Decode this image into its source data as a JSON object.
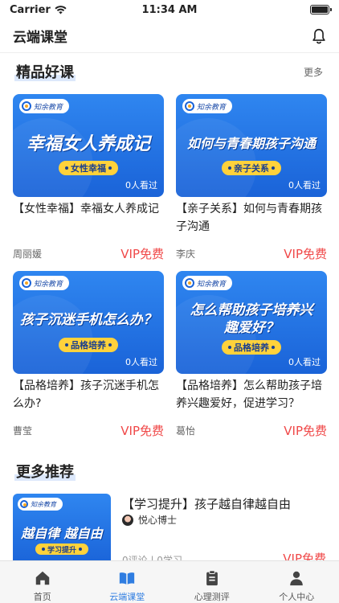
{
  "status": {
    "carrier": "Carrier",
    "time": "11:34 AM"
  },
  "header": {
    "title": "云端课堂"
  },
  "featured": {
    "title": "精品好课",
    "more": "更多",
    "courses": [
      {
        "thumb_title": "幸福女人养成记",
        "tag": "女性幸福",
        "views": "0人看过",
        "title": "【女性幸福】幸福女人养成记",
        "author": "周丽媛",
        "price": "VIP免费"
      },
      {
        "thumb_title": "如何与青春期孩子沟通",
        "tag": "亲子关系",
        "views": "0人看过",
        "title": "【亲子关系】如何与青春期孩子沟通",
        "author": "李庆",
        "price": "VIP免费"
      },
      {
        "thumb_title": "孩子沉迷手机怎么办？",
        "tag": "品格培养",
        "views": "0人看过",
        "title": "【品格培养】孩子沉迷手机怎么办?",
        "author": "曹莹",
        "price": "VIP免费"
      },
      {
        "thumb_title_1": "怎么帮助孩子培养兴",
        "thumb_title_2": "趣爱好？",
        "tag": "品格培养",
        "views": "0人看过",
        "title": "【品格培养】怎么帮助孩子培养兴趣爱好，促进学习？",
        "author": "葛怡",
        "price": "VIP免费"
      }
    ]
  },
  "recommend": {
    "title": "更多推荐",
    "items": [
      {
        "thumb_title": "越自律 越自由",
        "tag": "学习提升",
        "title": "【学习提升】孩子越自律越自由",
        "author": "悦心博士",
        "meta": "0评论 | 0学习",
        "price": "VIP免费"
      }
    ]
  },
  "tabs": [
    {
      "label": "首页",
      "icon": "home-icon"
    },
    {
      "label": "云端课堂",
      "icon": "book-icon"
    },
    {
      "label": "心理测评",
      "icon": "clipboard-icon"
    },
    {
      "label": "个人中心",
      "icon": "person-icon"
    }
  ],
  "colors": {
    "accent": "#2f7de1",
    "price": "#f04848",
    "thumb_blue": "#1a63d8",
    "tag_yellow": "#ffd23b"
  },
  "logo_text": "知余教育"
}
